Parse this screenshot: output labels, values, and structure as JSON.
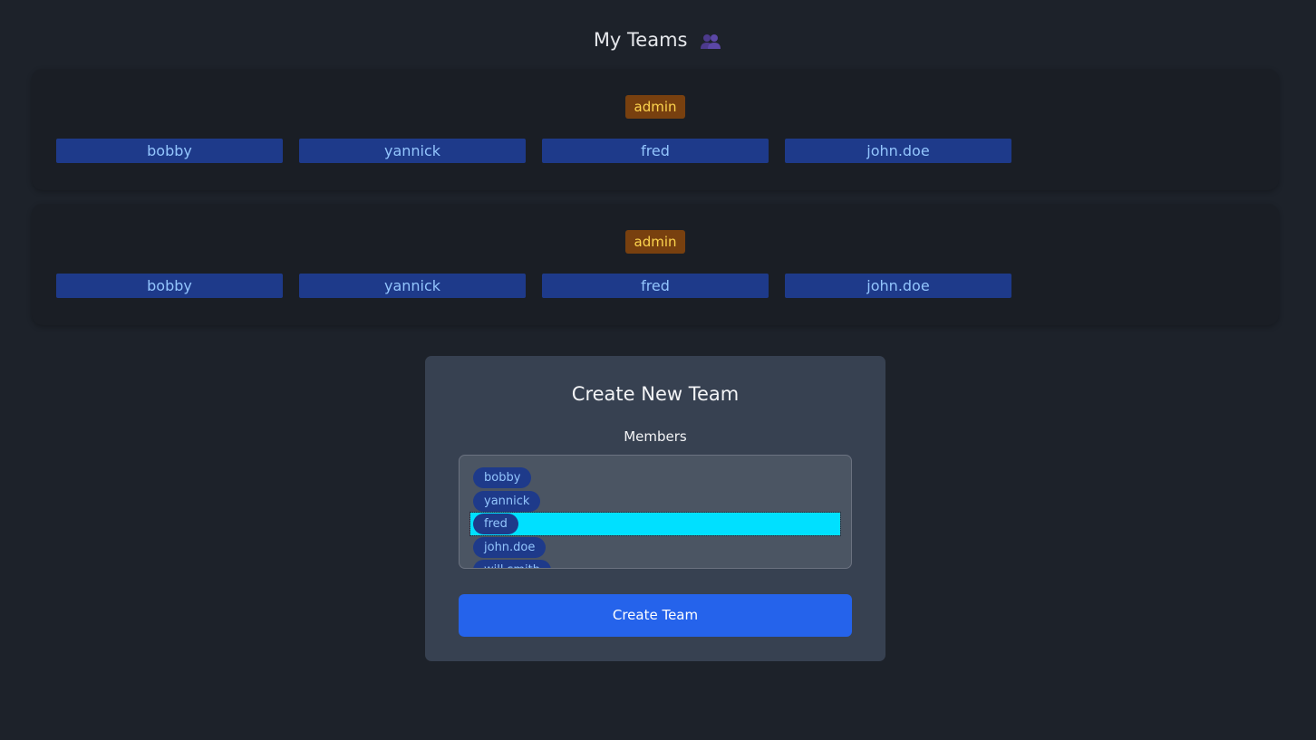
{
  "page": {
    "title": "My Teams",
    "title_icon": "busts-in-silhouette-icon"
  },
  "teams": [
    {
      "role": "admin",
      "members": [
        "bobby",
        "yannick",
        "fred",
        "john.doe"
      ]
    },
    {
      "role": "admin",
      "members": [
        "bobby",
        "yannick",
        "fred",
        "john.doe"
      ]
    }
  ],
  "create_team": {
    "title": "Create New Team",
    "members_label": "Members",
    "options": [
      "bobby",
      "yannick",
      "fred",
      "john.doe",
      "will.smith"
    ],
    "selected_option": "fred",
    "button_label": "Create Team"
  },
  "colors": {
    "background": "#1d222a",
    "card": "#1a1e25",
    "badge_bg": "#78400f",
    "badge_text": "#fcd34d",
    "chip_bg": "#1e3a8a",
    "chip_text": "#93c5fd",
    "panel": "#374151",
    "selected_highlight": "#00e0ff",
    "button": "#2563eb"
  }
}
